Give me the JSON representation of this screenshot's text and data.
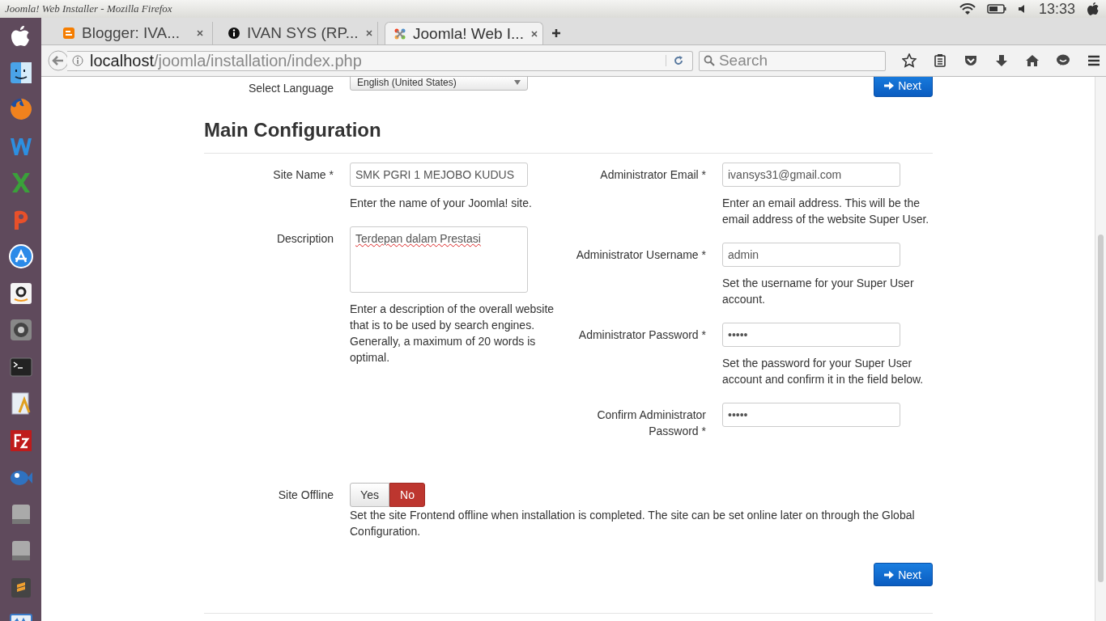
{
  "window": {
    "title": "Joomla! Web Installer - Mozilla Firefox",
    "clock": "13:33"
  },
  "tabs": [
    {
      "title": "Blogger: IVA...",
      "kind": "blogger",
      "selected": false
    },
    {
      "title": "IVAN SYS (RP...",
      "kind": "info",
      "selected": false
    },
    {
      "title": "Joomla! Web I...",
      "kind": "joomla",
      "selected": true
    }
  ],
  "address": {
    "host": "localhost",
    "path": "/joomla/installation/index.php"
  },
  "search": {
    "placeholder": "Search"
  },
  "page": {
    "language": {
      "label": "Select Language",
      "value": "English (United States)"
    },
    "next_top": "Next",
    "heading": "Main Configuration",
    "left_fields": [
      {
        "label": "Site Name *",
        "value": "SMK PGRI 1 MEJOBO KUDUS",
        "kind": "text",
        "help": "Enter the name of your Joomla! site."
      },
      {
        "label": "Description",
        "value": "Terdepan dalam Prestasi",
        "kind": "textarea",
        "help": "Enter a description of the overall website that is to be used by search engines. Generally, a maximum of 20 words is optimal."
      }
    ],
    "right_fields": [
      {
        "label": "Administrator Email *",
        "value": "ivansys31@gmail.com",
        "kind": "text",
        "help": "Enter an email address. This will be the email address of the website Super User."
      },
      {
        "label": "Administrator Username *",
        "value": "admin",
        "kind": "text",
        "help": "Set the username for your Super User account."
      },
      {
        "label": "Administrator Password *",
        "value": "•••••",
        "kind": "text",
        "help": "Set the password for your Super User account and confirm it in the field below."
      },
      {
        "label": "Confirm Administrator Password *",
        "value": "•••••",
        "kind": "text"
      }
    ],
    "site_offline": {
      "label": "Site Offline",
      "options": [
        {
          "label": "Yes",
          "selected": false
        },
        {
          "label": "No",
          "selected": true
        }
      ],
      "help": "Set the site Frontend offline when installation is completed. The site can be set online later on through the Global Configuration."
    },
    "next_bottom": "Next"
  }
}
